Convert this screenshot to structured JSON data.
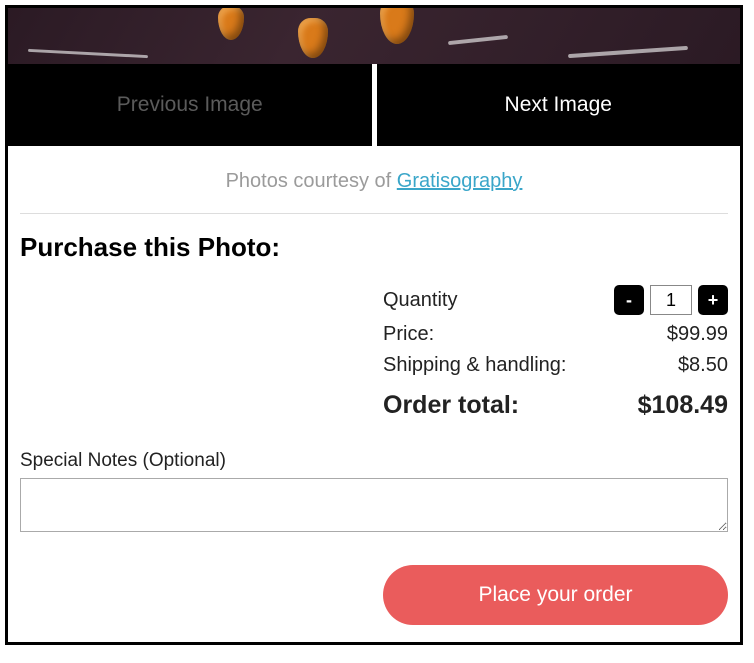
{
  "nav": {
    "prev_label": "Previous Image",
    "next_label": "Next Image"
  },
  "courtesy": {
    "prefix": "Photos courtesy of ",
    "link_text": "Gratisography"
  },
  "purchase": {
    "heading": "Purchase this Photo:",
    "qty_label": "Quantity",
    "qty_value": "1",
    "minus": "-",
    "plus": "+",
    "price_label": "Price:",
    "price_value": "$99.99",
    "shipping_label": "Shipping & handling:",
    "shipping_value": "$8.50",
    "total_label": "Order total:",
    "total_value": "$108.49",
    "notes_label": "Special Notes (Optional)",
    "place_order": "Place your order"
  }
}
